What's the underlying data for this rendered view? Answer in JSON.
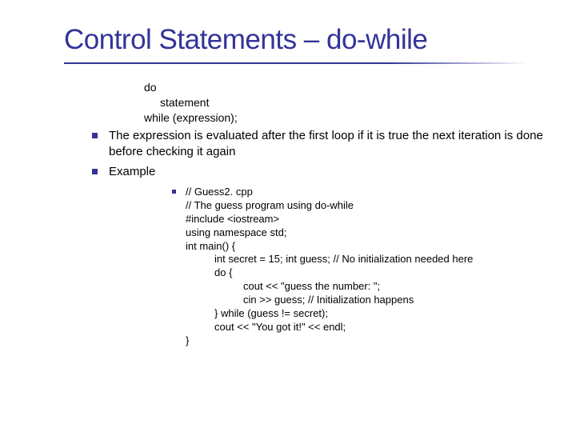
{
  "title": "Control Statements – do-while",
  "syntax": {
    "l1": "do",
    "l2": "statement",
    "l3": "while (expression);"
  },
  "bullets": {
    "b1": "The expression is evaluated after the first loop if it is true the next iteration is done before checking it again",
    "b2": "Example"
  },
  "code": {
    "c1": "// Guess2. cpp",
    "c2": "// The guess program using do-while",
    "c3": "#include <iostream>",
    "c4": "using namespace std;",
    "c5": "int main() {",
    "c6": "int secret = 15; int guess; // No initialization needed here",
    "c7": "do {",
    "c8": "cout << \"guess the number: \";",
    "c9": "cin >> guess; // Initialization happens",
    "c10": "} while (guess != secret);",
    "c11": "cout << \"You got it!\" << endl;",
    "c12": "}"
  }
}
